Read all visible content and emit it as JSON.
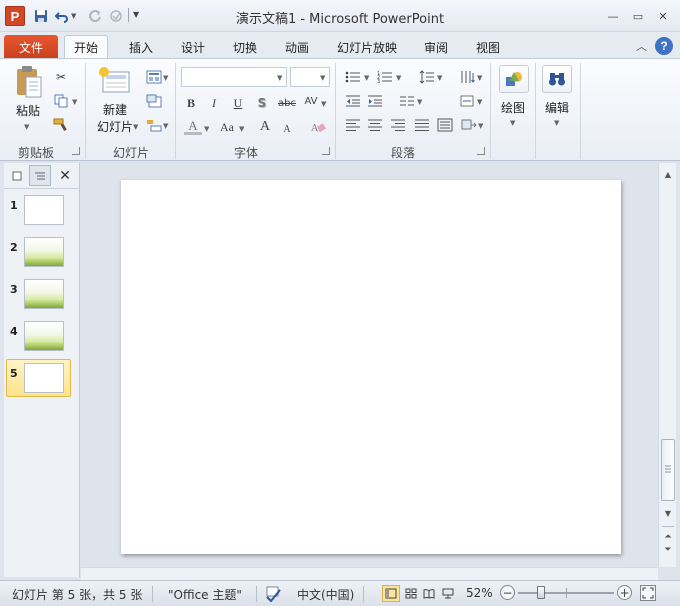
{
  "window": {
    "title": "演示文稿1  -  Microsoft PowerPoint",
    "app_icon_letter": "P",
    "controls": {
      "minimize": "—",
      "restore": "▭",
      "close": "✕"
    }
  },
  "quick_access": {
    "save_icon": "save-icon",
    "undo_icon": "undo-icon",
    "redo_icon": "redo-icon",
    "repeat_icon": "repeat-icon",
    "customize_icon": "customize-dropdown-icon"
  },
  "tabs": {
    "file": "文件",
    "items": [
      "开始",
      "插入",
      "设计",
      "切换",
      "动画",
      "幻灯片放映",
      "审阅",
      "视图"
    ],
    "active": "开始",
    "minimize_ribbon": "︿",
    "help": "?"
  },
  "ribbon": {
    "clipboard": {
      "label": "剪贴板",
      "paste": "粘贴"
    },
    "slides": {
      "label": "幻灯片",
      "new_slide_line1": "新建",
      "new_slide_line2": "幻灯片"
    },
    "font": {
      "label": "字体",
      "bold": "B",
      "italic": "I",
      "underline": "U",
      "shadow": "S",
      "strike": "abc",
      "spacing": "AV",
      "color": "A",
      "case": "Aa",
      "grow": "A",
      "shrink": "A"
    },
    "paragraph": {
      "label": "段落"
    },
    "drawing": {
      "label": "绘图"
    },
    "editing": {
      "label": "编辑"
    }
  },
  "slide_pane": {
    "thumbnails": [
      {
        "num": "1",
        "style": "blank"
      },
      {
        "num": "2",
        "style": "grass"
      },
      {
        "num": "3",
        "style": "grass"
      },
      {
        "num": "4",
        "style": "grass"
      },
      {
        "num": "5",
        "style": "blank",
        "selected": true
      }
    ],
    "close": "✕"
  },
  "status": {
    "slide_info": "幻灯片 第 5 张，共 5 张",
    "theme": "\"Office 主题\"",
    "language": "中文(中国)",
    "zoom": "52%",
    "zoom_level": 0.52
  },
  "colors": {
    "file_tab": "#d24726",
    "selected_thumb": "#ffe38a"
  }
}
